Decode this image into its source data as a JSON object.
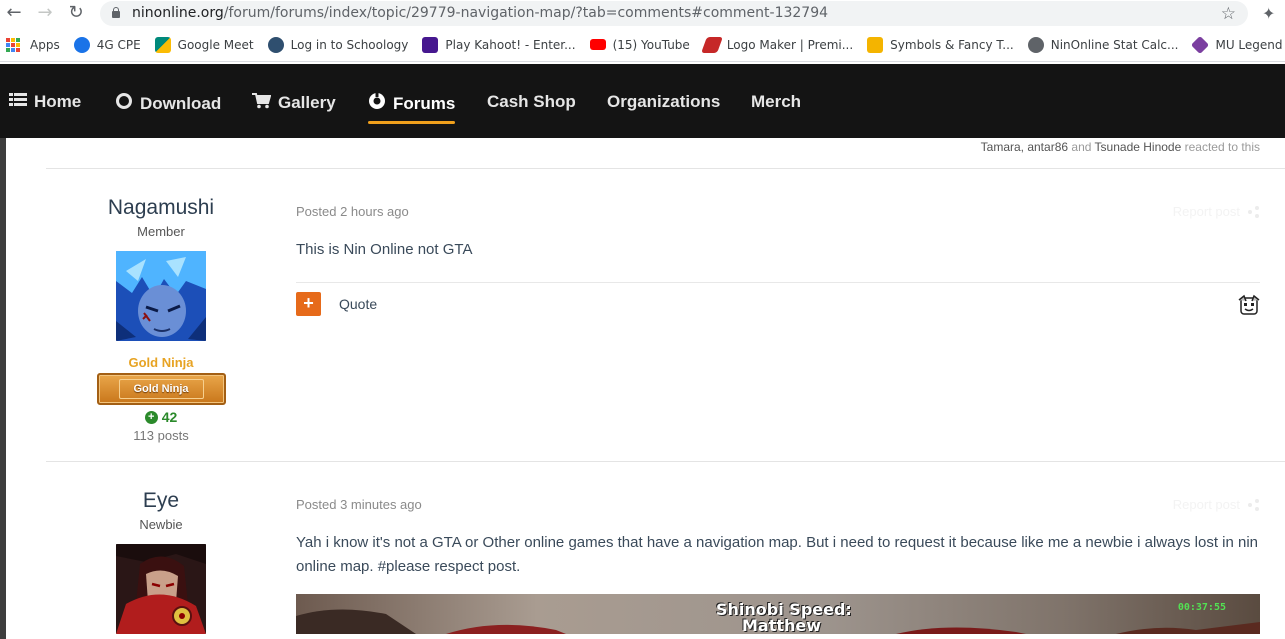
{
  "browser": {
    "url_host": "ninonline.org",
    "url_path": "/forum/forums/index/topic/29779-navigation-map/?tab=comments#comment-132794",
    "bookmarks": [
      {
        "label": "Apps",
        "color": "#4285f4"
      },
      {
        "label": "4G CPE",
        "color": "#1a73e8"
      },
      {
        "label": "Google Meet",
        "color": "#00897b"
      },
      {
        "label": "Log in to Schoology",
        "color": "#2f4f6f"
      },
      {
        "label": "Play Kahoot! - Enter...",
        "color": "#46178f"
      },
      {
        "label": "(15) YouTube",
        "color": "#ff0000"
      },
      {
        "label": "Logo Maker | Premi...",
        "color": "#c62828"
      },
      {
        "label": "Symbols & Fancy T...",
        "color": "#f4b400"
      },
      {
        "label": "NinOnline Stat Calc...",
        "color": "#5f6368"
      },
      {
        "label": "MU Legend Global",
        "color": "#7b3fa0"
      }
    ]
  },
  "nav": {
    "items": [
      {
        "label": "Home",
        "icon": "home-icon"
      },
      {
        "label": "Download",
        "icon": "download-icon"
      },
      {
        "label": "Gallery",
        "icon": "cart-icon"
      },
      {
        "label": "Forums",
        "icon": "forums-icon"
      },
      {
        "label": "Cash Shop",
        "icon": ""
      },
      {
        "label": "Organizations",
        "icon": ""
      },
      {
        "label": "Merch",
        "icon": ""
      }
    ],
    "active": "Forums",
    "accent": "#f0a01c"
  },
  "reactions": {
    "names": "Tamara, antar86",
    "and": "and",
    "last": "Tsunade Hinode",
    "suffix": "reacted to this"
  },
  "posts": [
    {
      "author": "Nagamushi",
      "rank": "Member",
      "group": "Gold Ninja",
      "badge": "Gold Ninja",
      "reputation": "42",
      "post_count": "113 posts",
      "posted": "Posted 2 hours ago",
      "text": "This is Nin Online not GTA",
      "quote_label": "Quote",
      "report_label": "Report post"
    },
    {
      "author": "Eye",
      "rank": "Newbie",
      "posted": "Posted 3 minutes ago",
      "text": "Yah i know it's not a GTA or Other online games that have a navigation map. But i need to request it because like me a newbie i always lost in nin online map. #please respect post.",
      "report_label": "Report post",
      "image": {
        "title": "Shinobi Speed:",
        "name": "Matthew",
        "timer": "00:37:55"
      }
    }
  ]
}
